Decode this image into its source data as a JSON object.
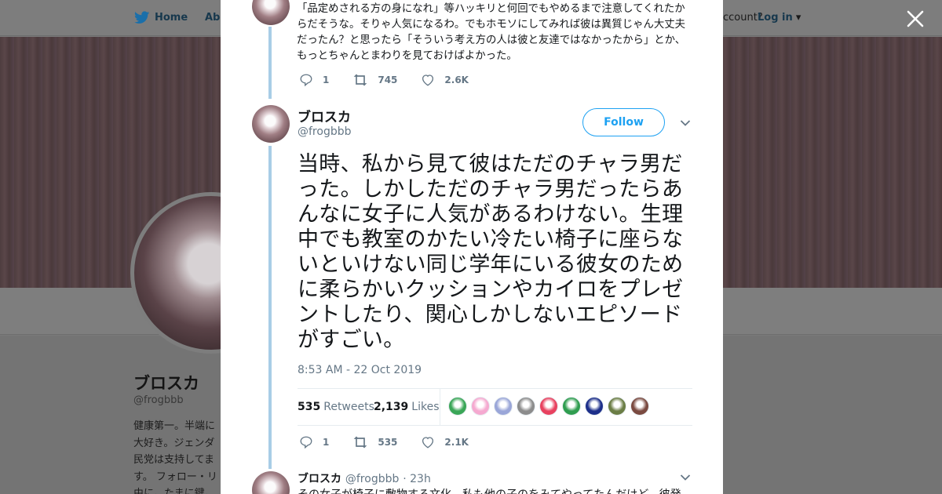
{
  "background": {
    "nav": {
      "home_label": "Home",
      "about_label": "Abo",
      "account_prompt": "ccount?",
      "login_label": "Log in"
    },
    "profile": {
      "name": "ブロスカ",
      "handle": "@frogbbb",
      "bio": "健康第一。半端に大好き。ジェンダ民党は支持してます。 フォロー・リ由に。たまに鍵。"
    }
  },
  "previous_tweet": {
    "text": "「品定めされる方の身になれ」等ハッキリと何回でもやめるまで注意してくれたからだそうな。そりゃ人気になるわ。でもホモソにしてみれば彼は異質じゃん大丈夫だったん？と思ったら「そういう考え方の人は彼と友達ではなかったから」とか、もっとちゃんとまわりを見ておけばよかった。",
    "replies": "1",
    "retweets": "745",
    "likes": "2.6K"
  },
  "main_tweet": {
    "author_name": "ブロスカ",
    "author_handle": "@frogbbb",
    "follow_label": "Follow",
    "text": "当時、私から見て彼はただのチャラ男だった。しかしただのチャラ男だったらあんなに女子に人気があるわけない。生理中でも教室のかたい冷たい椅子に座らないといけない同じ学年にいる彼女のために柔らかいクッションやカイロをプレゼントしたり、関心しかしないエピソードがすごい。",
    "timestamp": "8:53 AM - 22 Oct 2019",
    "retweets_count": "535",
    "retweets_label": "Retweets",
    "likes_count": "2,139",
    "likes_label": "Likes",
    "liker_colors": [
      "#3aa657",
      "#f5a9d0",
      "#9aa6d8",
      "#8c8c8c",
      "#e8415f",
      "#2f9d4f",
      "#1d2f8a",
      "#6b7d45",
      "#7a4a40"
    ],
    "replies": "1",
    "retweets": "535",
    "likes": "2.1K"
  },
  "next_tweet": {
    "author_name": "ブロスカ",
    "author_handle": "@frogbbb",
    "time": "· 23h",
    "text": "その女子が椅子に敷物する文化、私も他の子のをみてやってたんだけど、彼発"
  },
  "colors": {
    "accent": "#1da1f2",
    "thread_line": "#a8cde6",
    "muted": "#657786"
  }
}
